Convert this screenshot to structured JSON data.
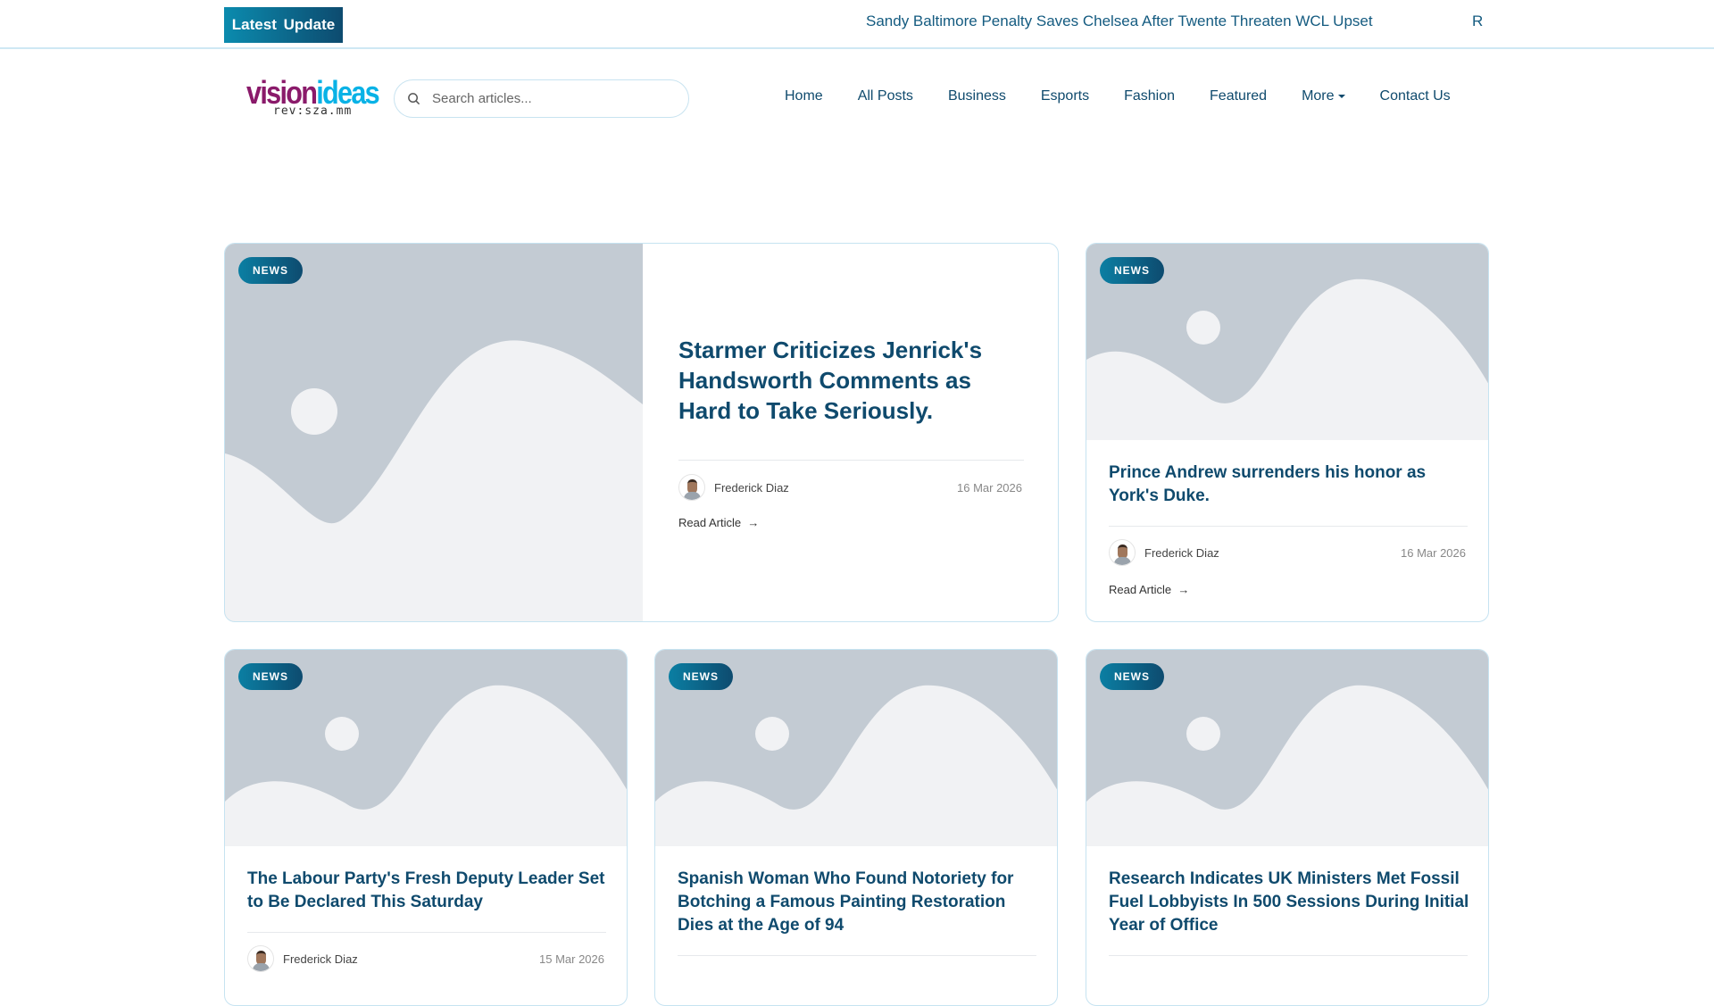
{
  "topbar": {
    "latest_label": "Latest Update",
    "ticker": "Sandy Baltimore Penalty Saves Chelsea After Twente Threaten WCL Upset",
    "ticker_next": "R"
  },
  "logo": {
    "word1": "vision",
    "word2": "ideas",
    "sub": "rev:sza.mm"
  },
  "search": {
    "placeholder": "Search articles..."
  },
  "nav": [
    "Home",
    "All Posts",
    "Business",
    "Esports",
    "Fashion",
    "Featured",
    "More",
    "Contact Us"
  ],
  "colors": {
    "brand": "#0f4a6d",
    "accent": "#0b8bae",
    "placeholder_bg": "#c3cbd3"
  },
  "articles": [
    {
      "badge": "NEWS",
      "title": "Starmer Criticizes Jenrick's Handsworth Comments as Hard to Take Seriously.",
      "author": "Frederick Diaz",
      "date": "16 Mar 2026",
      "read": "Read Article",
      "arrow": "→"
    },
    {
      "badge": "NEWS",
      "title": "Prince Andrew surrenders his honor as York's Duke.",
      "author": "Frederick Diaz",
      "date": "16 Mar 2026",
      "read": "Read Article",
      "arrow": "→"
    },
    {
      "badge": "NEWS",
      "title": "The Labour Party's Fresh Deputy Leader Set to Be Declared This Saturday",
      "author": "Frederick Diaz",
      "date": "15 Mar 2026"
    },
    {
      "badge": "NEWS",
      "title": "Spanish Woman Who Found Notoriety for Botching a Famous Painting Restoration Dies at the Age of 94"
    },
    {
      "badge": "NEWS",
      "title": "Research Indicates UK Ministers Met Fossil Fuel Lobbyists In 500 Sessions During Initial Year of Office"
    }
  ]
}
